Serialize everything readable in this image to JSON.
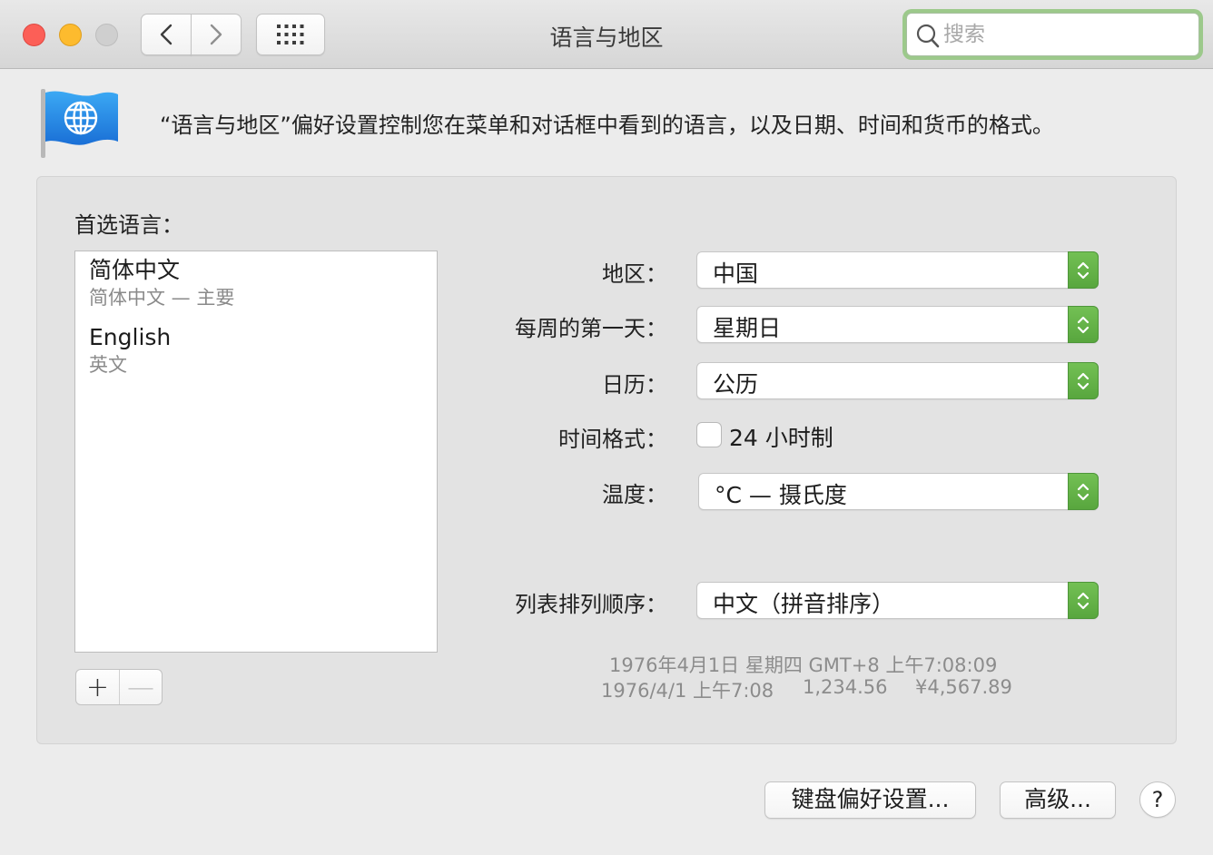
{
  "window": {
    "title": "语言与地区",
    "search_placeholder": "搜索"
  },
  "header": {
    "description": "“语言与地区”偏好设置控制您在菜单和对话框中看到的语言，以及日期、时间和货币的格式。"
  },
  "preferred_languages": {
    "label": "首选语言：",
    "items": [
      {
        "name": "简体中文",
        "subtitle": "简体中文 — 主要"
      },
      {
        "name": "English",
        "subtitle": "英文"
      }
    ],
    "add_label": "+",
    "remove_label": "—"
  },
  "settings": {
    "region": {
      "label": "地区：",
      "value": "中国"
    },
    "first_day": {
      "label": "每周的第一天：",
      "value": "星期日"
    },
    "calendar": {
      "label": "日历：",
      "value": "公历"
    },
    "time_format": {
      "label": "时间格式：",
      "checkbox_label": "24 小时制",
      "checked": false
    },
    "temperature": {
      "label": "温度：",
      "value": "°C — 摄氏度"
    },
    "sort_order": {
      "label": "列表排列顺序：",
      "value": "中文（拼音排序）"
    }
  },
  "samples": {
    "long_date": "1976年4月1日 星期四 GMT+8 上午7:08:09",
    "short_date": "1976/4/1 上午7:08",
    "number": "1,234.56",
    "currency": "¥4,567.89"
  },
  "footer": {
    "keyboard_button": "键盘偏好设置...",
    "advanced_button": "高级...",
    "help_button": "?"
  },
  "colors": {
    "popup_arrow_accent": "#5cae40",
    "search_focus_ring": "#9cc98b",
    "close": "#fc5f57",
    "minimize": "#fdbb2e"
  }
}
